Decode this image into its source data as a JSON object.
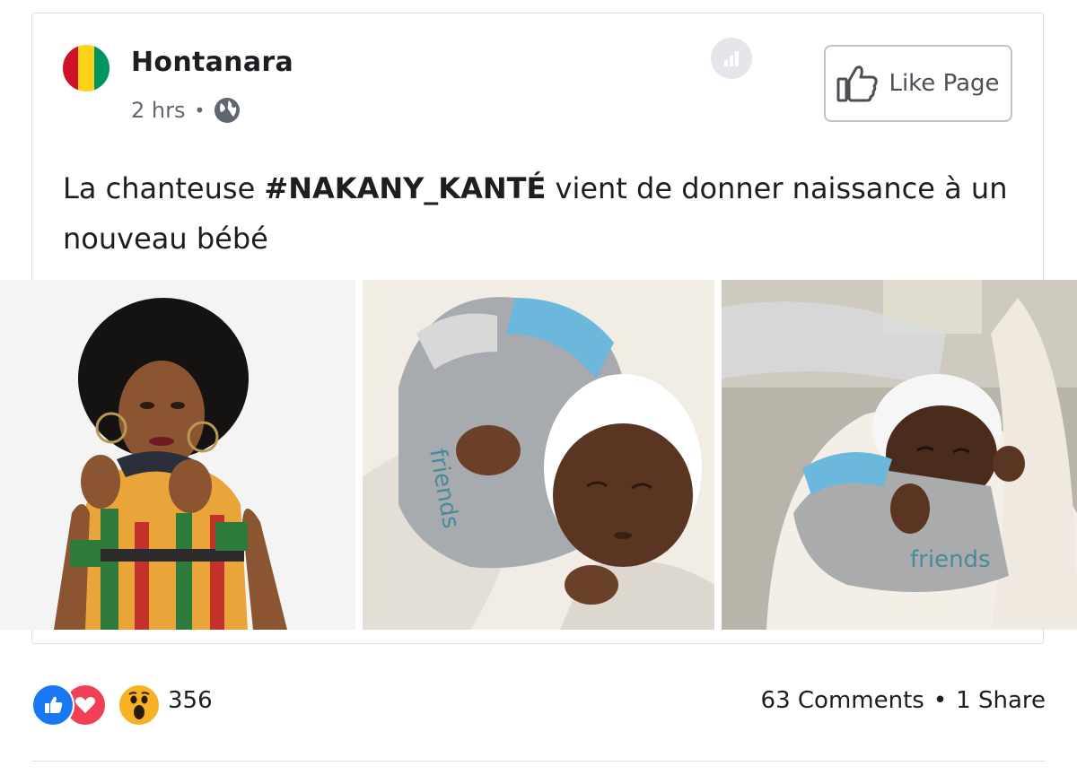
{
  "post": {
    "page_name": "Hontanara",
    "timestamp": "2 hrs",
    "separator": "•",
    "audience_icon": "globe-icon",
    "like_page_label": "Like Page",
    "text_part1": "La chanteuse ",
    "hashtag": "#NAKANY_KANTÉ",
    "text_part2": " vient de donner naissance à un nouveau bébé",
    "avatar_flag_colors": [
      "#ce1126",
      "#fcd116",
      "#009460"
    ]
  },
  "photos": [
    {
      "name": "singer-photo"
    },
    {
      "name": "newborn-photo-1"
    },
    {
      "name": "newborn-photo-2"
    }
  ],
  "reactions": {
    "icons": [
      "like-icon",
      "love-icon",
      "wow-icon"
    ],
    "count": "356",
    "comments": "63 Comments",
    "separator": "•",
    "shares": "1 Share"
  },
  "colors": {
    "like_blue": "#1877f2",
    "love_red": "#f33e58",
    "wow_yellow": "#f7b125"
  }
}
